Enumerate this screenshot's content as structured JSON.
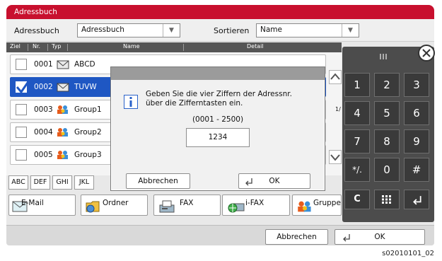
{
  "window": {
    "title": "Adressbuch"
  },
  "toolbar": {
    "addressbook_label": "Adressbuch",
    "addressbook_value": "Adressbuch",
    "sort_label": "Sortieren",
    "sort_value": "Name"
  },
  "table": {
    "columns": {
      "ziel": "Ziel",
      "nr": "Nr.",
      "typ": "Typ",
      "name": "Name",
      "detail": "Detail"
    },
    "rows": [
      {
        "nr": "0001",
        "name": "ABCD",
        "type": "envelope-icon",
        "checked": false
      },
      {
        "nr": "0002",
        "name": "TUVW",
        "type": "envelope-icon",
        "checked": true
      },
      {
        "nr": "0003",
        "name": "Group1",
        "type": "group-icon",
        "checked": false
      },
      {
        "nr": "0004",
        "name": "Group2",
        "type": "group-icon",
        "checked": false
      },
      {
        "nr": "0005",
        "name": "Group3",
        "type": "group-icon",
        "checked": false
      }
    ],
    "page_indicator": "1/"
  },
  "tabs": [
    "ABC",
    "DEF",
    "GHI",
    "JKL"
  ],
  "destinations": {
    "email": "E-Mail",
    "folder": "Ordner",
    "fax": "FAX",
    "ifax": "i-FAX",
    "group": "Gruppe"
  },
  "dialog": {
    "message": "Geben Sie die vier Ziffern der Adressnr. über die Zifferntasten ein.",
    "range": "(0001 - 2500)",
    "value": "1234",
    "cancel": "Abbrechen",
    "ok": "OK"
  },
  "numpad": {
    "keys": [
      "1",
      "2",
      "3",
      "4",
      "5",
      "6",
      "7",
      "8",
      "9",
      "*/.",
      "0",
      "#",
      "C"
    ]
  },
  "bottom": {
    "cancel": "Abbrechen",
    "ok": "OK"
  },
  "footer_code": "s02010101_02",
  "colors": {
    "title_red": "#c8102e",
    "selection_blue": "#1f57c3",
    "numpad_dark": "#4c4c4c"
  }
}
